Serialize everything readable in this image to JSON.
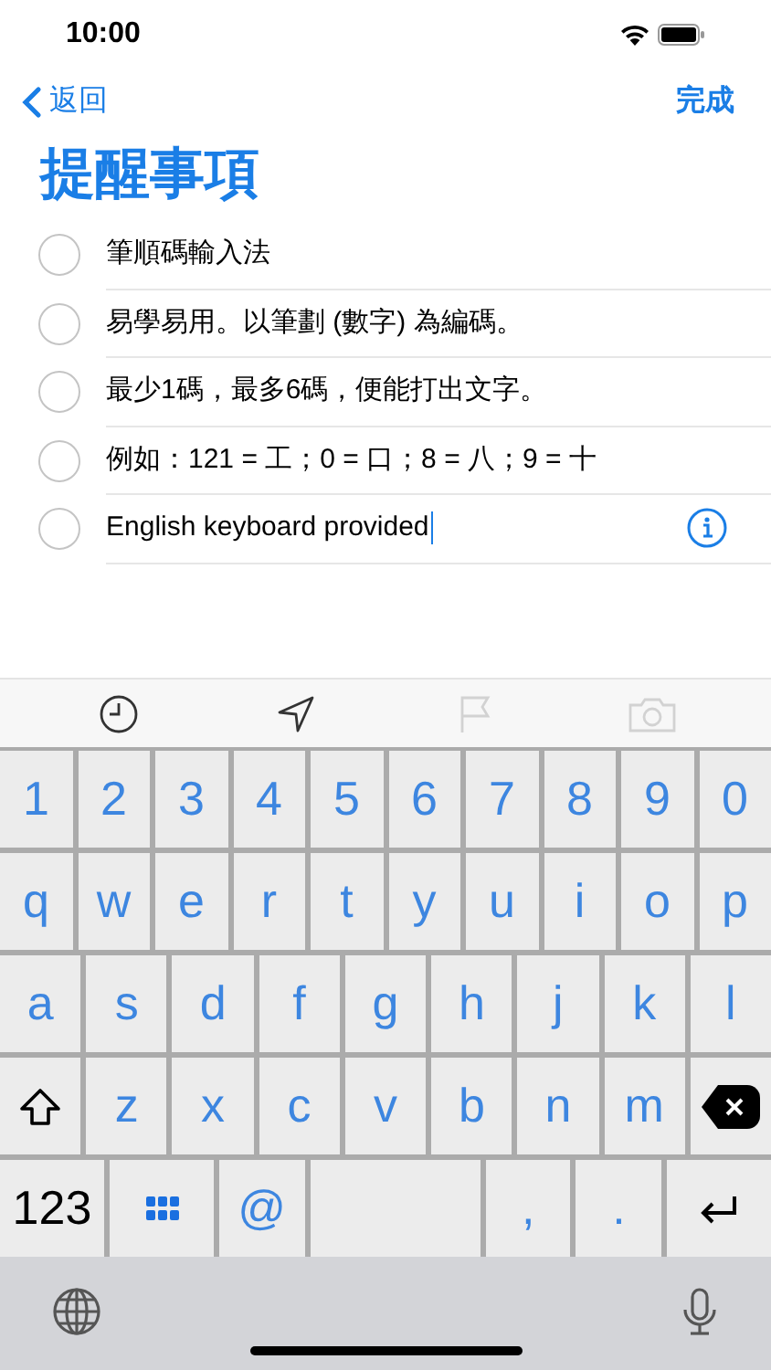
{
  "status_bar": {
    "time": "10:00"
  },
  "nav": {
    "back": "返回",
    "done": "完成"
  },
  "title": "提醒事項",
  "reminders": [
    {
      "text": "筆順碼輸入法",
      "checked": false,
      "editing": false
    },
    {
      "text": "易學易用。以筆劃 (數字) 為編碼。",
      "checked": false,
      "editing": false
    },
    {
      "text": "最少1碼，最多6碼，便能打出文字。",
      "checked": false,
      "editing": false
    },
    {
      "text": "例如：121 = 工；0 = 口；8 = 八；9 = 十",
      "checked": false,
      "editing": false
    },
    {
      "text": "English keyboard provided",
      "checked": false,
      "editing": true
    }
  ],
  "toolbar": [
    {
      "kind": "clock",
      "disabled": false
    },
    {
      "kind": "location",
      "disabled": false
    },
    {
      "kind": "flag",
      "disabled": true
    },
    {
      "kind": "camera",
      "disabled": true
    }
  ],
  "keyboard": {
    "number_row": [
      {
        "kind": "char",
        "label": "1"
      },
      {
        "kind": "char",
        "label": "2"
      },
      {
        "kind": "char",
        "label": "3"
      },
      {
        "kind": "char",
        "label": "4"
      },
      {
        "kind": "char",
        "label": "5"
      },
      {
        "kind": "char",
        "label": "6"
      },
      {
        "kind": "char",
        "label": "7"
      },
      {
        "kind": "char",
        "label": "8"
      },
      {
        "kind": "char",
        "label": "9"
      },
      {
        "kind": "char",
        "label": "0"
      }
    ],
    "top_row": [
      {
        "kind": "char",
        "label": "q"
      },
      {
        "kind": "char",
        "label": "w"
      },
      {
        "kind": "char",
        "label": "e"
      },
      {
        "kind": "char",
        "label": "r"
      },
      {
        "kind": "char",
        "label": "t"
      },
      {
        "kind": "char",
        "label": "y"
      },
      {
        "kind": "char",
        "label": "u"
      },
      {
        "kind": "char",
        "label": "i"
      },
      {
        "kind": "char",
        "label": "o"
      },
      {
        "kind": "char",
        "label": "p"
      }
    ],
    "middle_row": [
      {
        "kind": "char",
        "label": "a"
      },
      {
        "kind": "char",
        "label": "s"
      },
      {
        "kind": "char",
        "label": "d"
      },
      {
        "kind": "char",
        "label": "f"
      },
      {
        "kind": "char",
        "label": "g"
      },
      {
        "kind": "char",
        "label": "h"
      },
      {
        "kind": "char",
        "label": "j"
      },
      {
        "kind": "char",
        "label": "k"
      },
      {
        "kind": "char",
        "label": "l"
      }
    ],
    "lower_row": [
      {
        "kind": "shift"
      },
      {
        "kind": "char",
        "label": "z"
      },
      {
        "kind": "char",
        "label": "x"
      },
      {
        "kind": "char",
        "label": "c"
      },
      {
        "kind": "char",
        "label": "v"
      },
      {
        "kind": "char",
        "label": "b"
      },
      {
        "kind": "char",
        "label": "n"
      },
      {
        "kind": "char",
        "label": "m"
      },
      {
        "kind": "delete"
      }
    ],
    "bottom_row": [
      {
        "kind": "mode",
        "label": "123"
      },
      {
        "kind": "grid"
      },
      {
        "kind": "char",
        "label": "@"
      },
      {
        "kind": "space"
      },
      {
        "kind": "char",
        "label": ","
      },
      {
        "kind": "char",
        "label": "."
      },
      {
        "kind": "return"
      }
    ]
  }
}
